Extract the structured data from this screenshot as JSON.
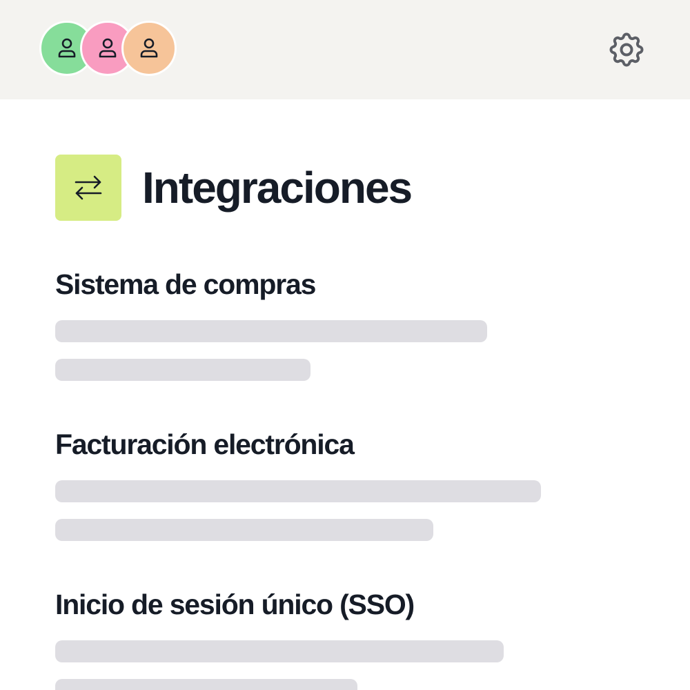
{
  "header": {
    "avatars": [
      {
        "icon": "user-icon",
        "color": "#86dd9a"
      },
      {
        "icon": "user-icon",
        "color": "#f99cc0"
      },
      {
        "icon": "user-icon",
        "color": "#f6c499"
      }
    ],
    "settings_icon": "gear-icon"
  },
  "page": {
    "title": "Integraciones",
    "icon": "arrows-exchange-icon",
    "icon_color": "#d6ec84"
  },
  "sections": [
    {
      "title": "Sistema de compras"
    },
    {
      "title": "Facturación electrónica"
    },
    {
      "title": "Inicio de sesión único (SSO)"
    }
  ],
  "colors": {
    "text": "#161c27",
    "header_bg": "#f4f3f0",
    "placeholder": "#dedde2",
    "icon_stroke": "#5c5f66"
  }
}
